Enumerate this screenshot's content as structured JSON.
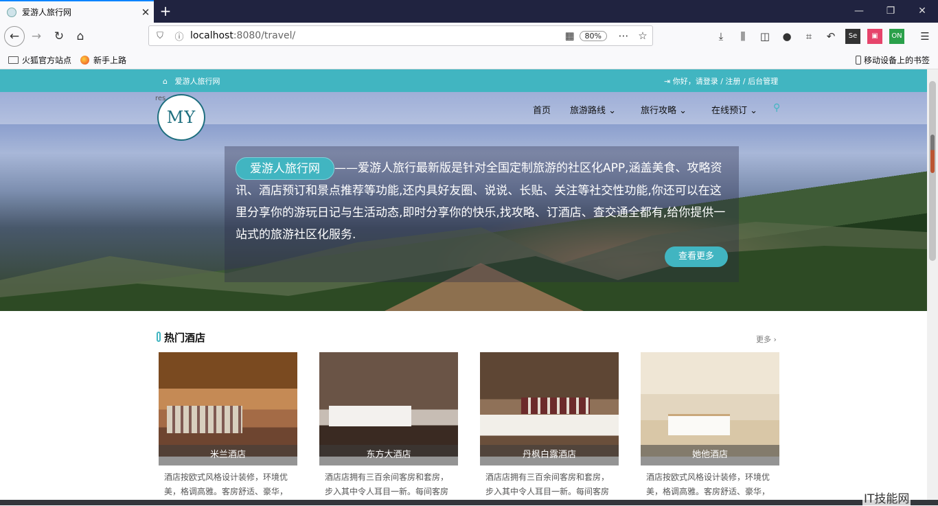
{
  "browser": {
    "tab_title": "爱游人旅行网",
    "tab_close": "✕",
    "new_tab": "+",
    "url_host": "localhost",
    "url_rest": ":8080/travel/",
    "zoom": "80%",
    "bookmarks": [
      "火狐官方站点",
      "新手上路"
    ],
    "mobile_bookmarks": "移动设备上的书签"
  },
  "site": {
    "top_left": "爱游人旅行网",
    "top_right": "你好，请登录 / 注册 / 后台管理",
    "logo_prefix": "res",
    "logo_text": "MY",
    "menu": [
      "首页",
      "旅游路线",
      "旅行攻略",
      "在线预订"
    ],
    "intro_pill": "爱游人旅行网",
    "intro_body": "——爱游人旅行最新版是针对全国定制旅游的社区化APP,涵盖美食、攻略资讯、酒店预订和景点推荐等功能,还内具好友圈、说说、长贴、关注等社交性功能,你还可以在这里分享你的游玩日记与生活动态,即时分享你的快乐,找攻略、订酒店、查交通全都有,给你提供一站式的旅游社区化服务.",
    "more_button": "查看更多",
    "section_title": "热门酒店",
    "section_more": "更多 ›"
  },
  "hotels": [
    {
      "name": "米兰酒店",
      "desc": "酒店按欧式风格设计装修，环境优美，格调高雅。客房舒适、豪华，餐"
    },
    {
      "name": "东方大酒店",
      "desc": "酒店店拥有三百余间客房和套房，步入其中令人耳目一新。每间客房均配"
    },
    {
      "name": "丹枫白露酒店",
      "desc": "酒店店拥有三百余间客房和套房，步入其中令人耳目一新。每间客房均配"
    },
    {
      "name": "她他酒店",
      "desc": "酒店按欧式风格设计装修，环境优美，格调高雅。客房舒适、豪华，餐"
    }
  ],
  "watermark": "IT技能网"
}
